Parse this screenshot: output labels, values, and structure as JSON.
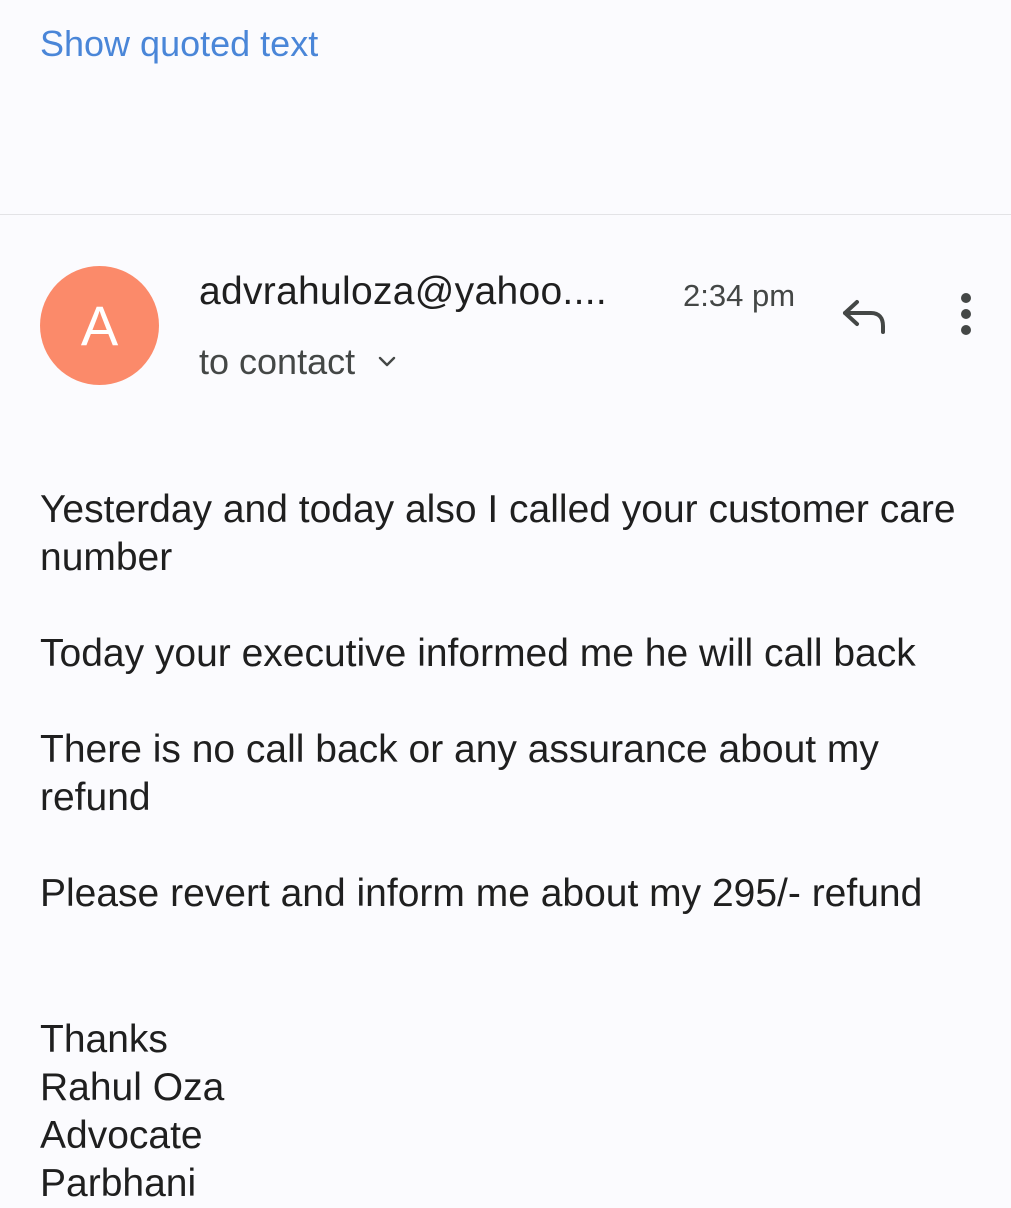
{
  "quoted": {
    "link_label": "Show quoted text"
  },
  "message": {
    "avatar_letter": "A",
    "sender": "advrahuloza@yahoo....",
    "time": "2:34 pm",
    "recipient_label": "to contact",
    "icons": {
      "reply": "reply-icon",
      "more": "more-vert-icon",
      "expand": "chevron-down-icon"
    },
    "colors": {
      "avatar": "#fb8a6a",
      "link": "#4a86d8"
    },
    "body": [
      "Yesterday and today also I called your customer care number",
      "Today your executive informed me he will call back",
      "There is no call back or any assurance about my refund",
      "Please revert and inform me about my 295/- refund"
    ],
    "signature": [
      "Thanks",
      "Rahul Oza",
      "Advocate",
      "Parbhani"
    ]
  }
}
